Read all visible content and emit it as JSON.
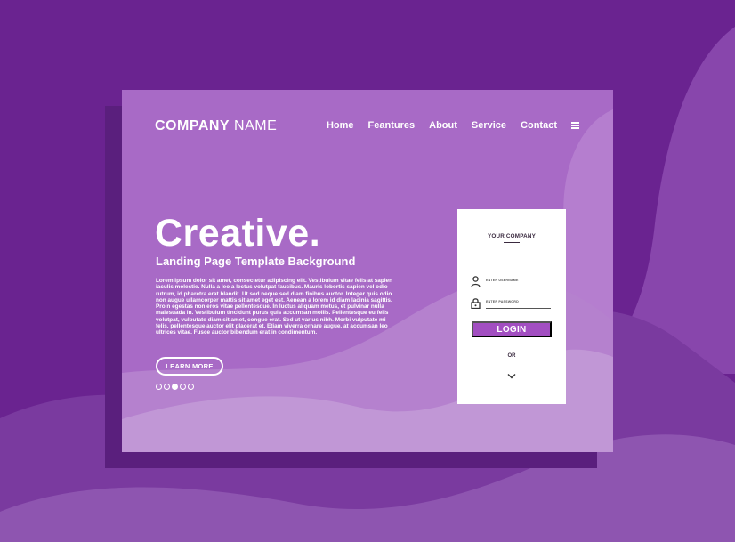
{
  "colors": {
    "background": "#6a2390",
    "card": "#a86ac6",
    "login_button": "#a24ec1",
    "text_light": "#ffffff"
  },
  "header": {
    "logo_bold": "COMPANY",
    "logo_light": "NAME",
    "nav": [
      "Home",
      "Feantures",
      "About",
      "Service",
      "Contact"
    ],
    "menu_icon": "hamburger-icon"
  },
  "hero": {
    "title": "Creative.",
    "subtitle": "Landing Page Template Background",
    "body": "Lorem ipsum dolor sit amet, consectetur adipiscing elit. Vestibulum vitae felis at sapien iaculis molestie. Nulla a leo a lectus volutpat faucibus. Mauris lobortis sapien vel odio rutrum, id pharetra erat blandit. Ut sed neque sed diam finibus auctor. Integer quis odio non augue ullamcorper mattis sit amet eget est. Aenean a lorem id diam lacinia sagittis. Proin egestas non eros vitae pellentesque. In luctus aliquam metus, et pulvinar nulla malesuada in. Vestibulum tincidunt purus quis accumsan mollis. Pellentesque eu felis volutpat, vulputate diam sit amet, congue erat. Sed ut varius nibh. Morbi vulputate mi felis, pellentesque auctor elit placerat et. Etiam viverra ornare augue, at accumsan leo ultrices vitae. Fusce auctor bibendum erat in condimentum.",
    "cta_label": "LEARN MORE",
    "carousel_dots": 5,
    "active_dot": 3
  },
  "login": {
    "title": "YOUR COMPANY",
    "username_label": "ENTER USERNAME",
    "password_label": "ENTER PASSWORD",
    "button_label": "LOGIN",
    "or_label": "OR",
    "user_icon": "user-icon",
    "lock_icon": "lock-icon",
    "expand_icon": "chevron-down-icon"
  }
}
